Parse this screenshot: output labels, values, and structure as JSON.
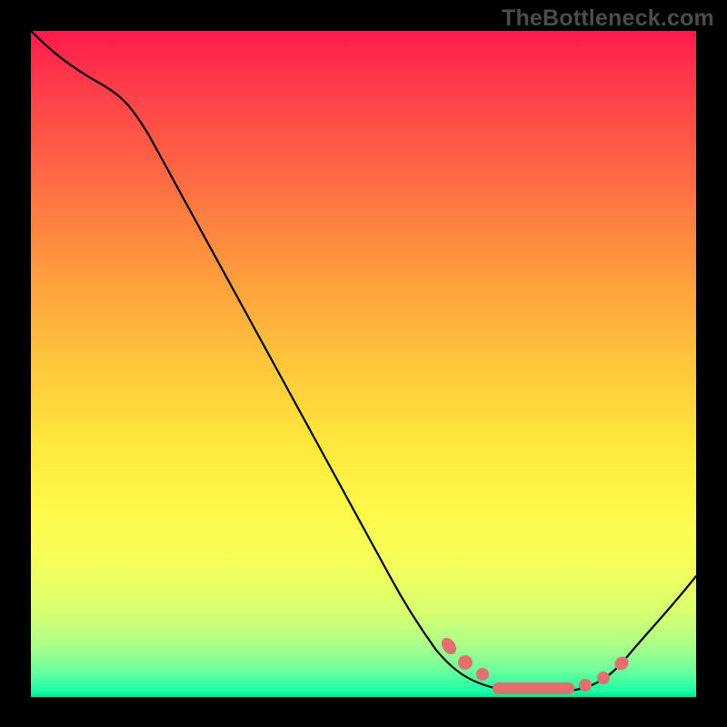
{
  "watermark": "TheBottleneck.com",
  "colors": {
    "background": "#000000",
    "curve": "#000000",
    "bead": "#e07070",
    "gradient_top": "#ff1a4d",
    "gradient_bottom": "#00e59c"
  },
  "chart_data": {
    "type": "line",
    "title": "",
    "xlabel": "",
    "ylabel": "",
    "xlim": [
      0,
      100
    ],
    "ylim": [
      0,
      100
    ],
    "x": [
      0,
      6,
      11,
      54,
      62,
      67,
      72,
      78,
      84,
      88,
      94,
      100
    ],
    "values": [
      100,
      97,
      93,
      18,
      8,
      4,
      2,
      1,
      1,
      2,
      9,
      18
    ],
    "marker_points": [
      {
        "x": 62,
        "y": 8
      },
      {
        "x": 64,
        "y": 6
      },
      {
        "x": 69,
        "y": 3
      },
      {
        "x": 72,
        "y": 2
      },
      {
        "x": 75,
        "y": 1.3
      },
      {
        "x": 78,
        "y": 1
      },
      {
        "x": 81,
        "y": 1
      },
      {
        "x": 84,
        "y": 1.1
      },
      {
        "x": 87,
        "y": 2
      },
      {
        "x": 89,
        "y": 3.5
      }
    ],
    "annotations": []
  }
}
